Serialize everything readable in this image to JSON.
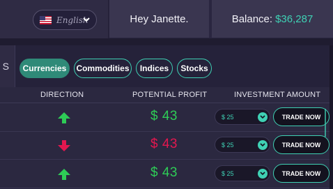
{
  "header": {
    "language": {
      "label": "English",
      "flag_icon": "us-flag-icon"
    },
    "greeting": "Hey Janette.",
    "balance_label": "Balance:",
    "balance_value": "$36,287"
  },
  "tabs": {
    "partial_tab": "S",
    "items": [
      {
        "label": "Currencies",
        "active": true
      },
      {
        "label": "Commodities",
        "active": false
      },
      {
        "label": "Indices",
        "active": false
      },
      {
        "label": "Stocks",
        "active": false
      }
    ]
  },
  "table": {
    "headers": [
      "DIRECTION",
      "POTENTIAL PROFIT",
      "INVESTMENT AMOUNT"
    ],
    "rows": [
      {
        "direction": "up",
        "profit": "$ 43",
        "amount": "$ 25",
        "action": "TRADE NOW"
      },
      {
        "direction": "down",
        "profit": "$ 43",
        "amount": "$ 25",
        "action": "TRADE NOW"
      },
      {
        "direction": "up",
        "profit": "$ 43",
        "amount": "$ 25",
        "action": "TRADE NOW"
      }
    ]
  },
  "colors": {
    "accent": "#3fd1b4",
    "up": "#2ecc56",
    "down": "#e3174f",
    "background": "#1f1c30"
  }
}
